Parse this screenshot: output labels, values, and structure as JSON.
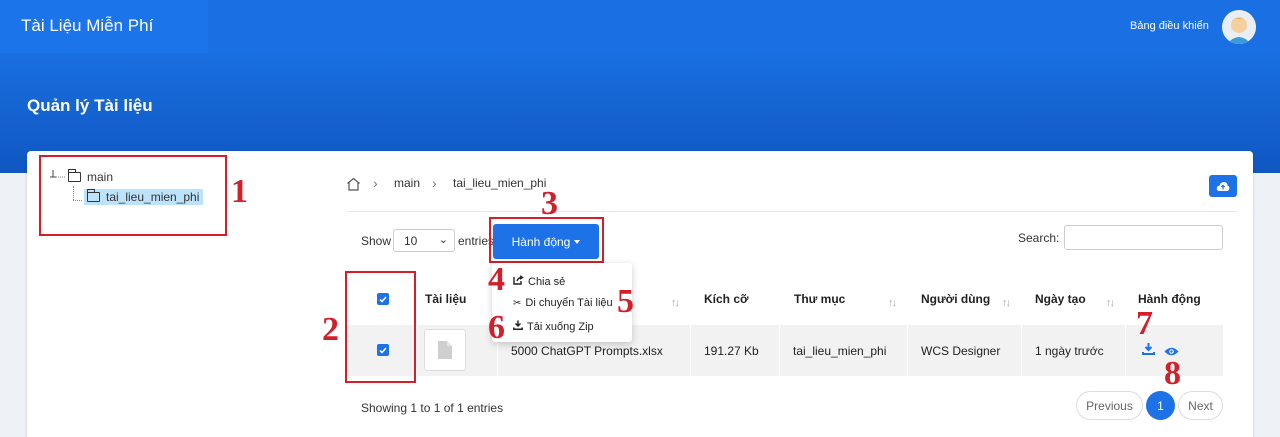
{
  "header": {
    "brand": "Tài Liệu Miễn Phí",
    "dashboard_link": "Bảng điều khiển"
  },
  "page": {
    "title": "Quản lý Tài liệu"
  },
  "tree": {
    "root": "main",
    "child": "tai_lieu_mien_phi"
  },
  "breadcrumb": {
    "items": [
      "main",
      "tai_lieu_mien_phi"
    ]
  },
  "table_controls": {
    "show_label": "Show",
    "page_size": "10",
    "entries_label": "entries",
    "action_button": "Hành động",
    "search_label": "Search:",
    "search_value": ""
  },
  "action_menu": {
    "items": [
      "Chia sẻ",
      "Di chuyển Tài liệu",
      "Tải xuống Zip"
    ]
  },
  "table": {
    "columns": [
      "Tài liệu",
      "Kích cỡ",
      "Thư mục",
      "Người dùng",
      "Ngày tạo",
      "Hành động"
    ],
    "rows": [
      {
        "name": "5000 ChatGPT Prompts.xlsx",
        "size": "191.27 Kb",
        "folder": "tai_lieu_mien_phi",
        "user": "WCS Designer",
        "created": "1 ngày trước"
      }
    ]
  },
  "footer": {
    "info": "Showing 1 to 1 of 1 entries",
    "previous": "Previous",
    "current_page": "1",
    "next": "Next"
  },
  "callouts": [
    "1",
    "2",
    "3",
    "4",
    "5",
    "6",
    "7",
    "8"
  ],
  "colors": {
    "primary": "#1d72e8",
    "callout": "#d21f2a",
    "selected_node": "#bde3fb"
  }
}
